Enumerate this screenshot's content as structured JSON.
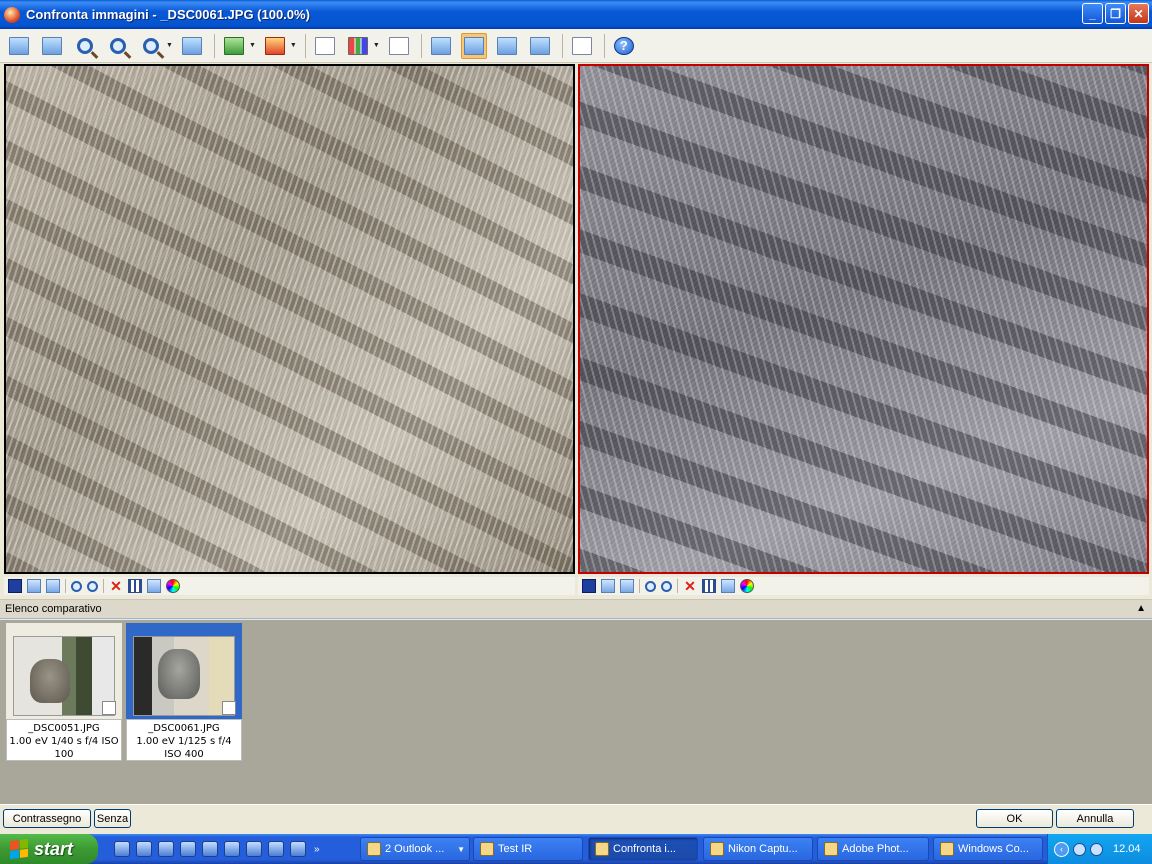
{
  "window": {
    "title": "Confronta immagini - _DSC0061.JPG (100.0%)",
    "minimize": "_",
    "restore": "❐",
    "close": "✕"
  },
  "toolbar": {
    "icons": [
      "add-image-icon",
      "remove-image-icon",
      "zoom-in-icon",
      "zoom-out-icon",
      "zoom-dropdown-icon",
      "properties-icon",
      "filter-green-icon",
      "filter-red-icon",
      "checklist-icon",
      "histogram-icon",
      "report-icon",
      "single-view-icon",
      "side-by-side-view-icon",
      "three-column-view-icon",
      "grid-view-icon",
      "print-icon",
      "help-icon"
    ],
    "help_label": "?"
  },
  "comparison_list": {
    "title": "Elenco comparativo",
    "pin": "▲",
    "items": [
      {
        "line1": "_DSC0051.JPG",
        "line2": "1.00 eV 1/40 s f/4 ISO",
        "line3": "100",
        "selected": false
      },
      {
        "line1": "_DSC0061.JPG",
        "line2": "1.00 eV 1/125 s f/4",
        "line3": "ISO 400",
        "selected": true
      }
    ]
  },
  "bottom": {
    "mark_label": "Contrassegno",
    "none_label": "Senza",
    "ok_label": "OK",
    "cancel_label": "Annulla"
  },
  "taskbar": {
    "start_label": "start",
    "quick_launch_more": "»",
    "tasks": [
      {
        "label": "2 Outlook ...",
        "active": false
      },
      {
        "label": "Test IR",
        "active": false
      },
      {
        "label": "Confronta i...",
        "active": true
      },
      {
        "label": "Nikon Captu...",
        "active": false
      },
      {
        "label": "Adobe Phot...",
        "active": false
      },
      {
        "label": "Windows Co...",
        "active": false
      }
    ],
    "clock": "12.04",
    "tray_chevron": "‹"
  },
  "colors": {
    "selected_thumb": "#3068c8",
    "active_pane_border": "#c00000",
    "taskbar_blue": "#245edb",
    "start_green": "#3c9a33"
  }
}
